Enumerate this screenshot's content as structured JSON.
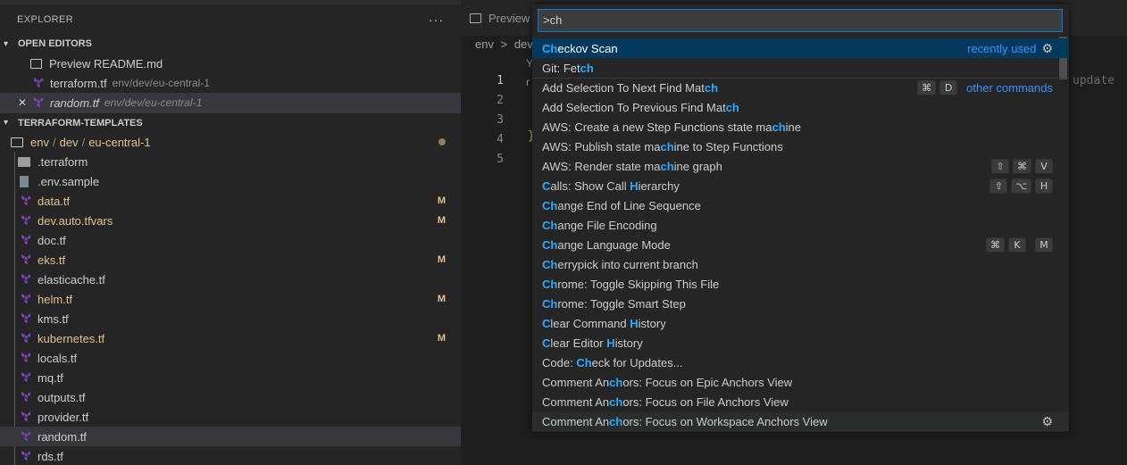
{
  "explorer": {
    "title": "EXPLORER",
    "more_label": "···",
    "open_editors": {
      "title": "OPEN EDITORS",
      "items": [
        {
          "label": "Preview README.md",
          "desc": ""
        },
        {
          "label": "terraform.tf",
          "desc": "env/dev/eu-central-1"
        },
        {
          "label": "random.tf",
          "desc": "env/dev/eu-central-1"
        }
      ],
      "close_label": "✕"
    },
    "workspace": {
      "title": "TERRAFORM-TEMPLATES",
      "path": [
        "env",
        "dev",
        "eu-central-1"
      ],
      "path_sep": "/",
      "files": [
        {
          "label": ".terraform",
          "badge": ""
        },
        {
          "label": ".env.sample",
          "badge": ""
        },
        {
          "label": "data.tf",
          "badge": "M"
        },
        {
          "label": "dev.auto.tfvars",
          "badge": "M"
        },
        {
          "label": "doc.tf",
          "badge": ""
        },
        {
          "label": "eks.tf",
          "badge": "M"
        },
        {
          "label": "elasticache.tf",
          "badge": ""
        },
        {
          "label": "helm.tf",
          "badge": "M"
        },
        {
          "label": "kms.tf",
          "badge": ""
        },
        {
          "label": "kubernetes.tf",
          "badge": "M"
        },
        {
          "label": "locals.tf",
          "badge": ""
        },
        {
          "label": "mq.tf",
          "badge": ""
        },
        {
          "label": "outputs.tf",
          "badge": ""
        },
        {
          "label": "provider.tf",
          "badge": ""
        },
        {
          "label": "random.tf",
          "badge": ""
        },
        {
          "label": "rds.tf",
          "badge": ""
        }
      ]
    }
  },
  "editor": {
    "tab_label": "Preview",
    "breadcrumb": [
      "env",
      "dev"
    ],
    "breadcrumb_sep": ">",
    "line_numbers": [
      "1",
      "2",
      "3",
      "4",
      "5"
    ],
    "ghost_text": "update",
    "brace": "}",
    "gutter_fragment_1": "Y",
    "gutter_fragment_2": "r"
  },
  "palette": {
    "input_value": ">ch",
    "recently_used_label": "recently used",
    "other_commands_label": "other commands",
    "items": [
      {
        "pre": "",
        "hl": "Ch",
        "post": "eckov Scan"
      },
      {
        "pre": "Git: Fet",
        "hl": "ch",
        "post": ""
      },
      {
        "pre": "Add Selection To Next Find Mat",
        "hl": "ch",
        "post": ""
      },
      {
        "pre": "Add Selection To Previous Find Mat",
        "hl": "ch",
        "post": ""
      },
      {
        "pre": "AWS: Create a new Step Functions state ma",
        "hl": "ch",
        "post": "ine"
      },
      {
        "pre": "AWS: Publish state ma",
        "hl": "ch",
        "post": "ine to Step Functions"
      },
      {
        "pre": "AWS: Render state ma",
        "hl": "ch",
        "post": "ine graph"
      },
      {
        "pre": "",
        "hl": "C",
        "post": "alls: Show Call ",
        "hl2": "H",
        "post2": "ierarchy"
      },
      {
        "pre": "",
        "hl": "Ch",
        "post": "ange End of Line Sequence"
      },
      {
        "pre": "",
        "hl": "Ch",
        "post": "ange File Encoding"
      },
      {
        "pre": "",
        "hl": "Ch",
        "post": "ange Language Mode"
      },
      {
        "pre": "",
        "hl": "Ch",
        "post": "errypick into current branch"
      },
      {
        "pre": "",
        "hl": "Ch",
        "post": "rome: Toggle Skipping This File"
      },
      {
        "pre": "",
        "hl": "Ch",
        "post": "rome: Toggle Smart Step"
      },
      {
        "pre": "",
        "hl": "C",
        "post": "lear Command ",
        "hl2": "H",
        "post2": "istory"
      },
      {
        "pre": "",
        "hl": "C",
        "post": "lear Editor ",
        "hl2": "H",
        "post2": "istory"
      },
      {
        "pre": "Code: ",
        "hl": "Ch",
        "post": "eck for Updates..."
      },
      {
        "pre": "Comment An",
        "hl": "ch",
        "post": "ors: Focus on Epic Anchors View"
      },
      {
        "pre": "Comment An",
        "hl": "ch",
        "post": "ors: Focus on File Anchors View"
      },
      {
        "pre": "Comment An",
        "hl": "ch",
        "post": "ors: Focus on Workspace Anchors View"
      }
    ],
    "keybindings": {
      "add_next": [
        "⌘",
        "D"
      ],
      "render_graph": [
        "⇧",
        "⌘",
        "V"
      ],
      "call_hierarchy": [
        "⇧",
        "⌥",
        "H"
      ],
      "language_mode": [
        [
          "⌘",
          "K"
        ],
        [
          "M"
        ]
      ]
    },
    "gear_icon": "⚙"
  },
  "colors": {
    "accent": "#007fd4",
    "highlight": "#2aaaff",
    "modified": "#e2c08d",
    "terraform": "#7b42bc"
  }
}
